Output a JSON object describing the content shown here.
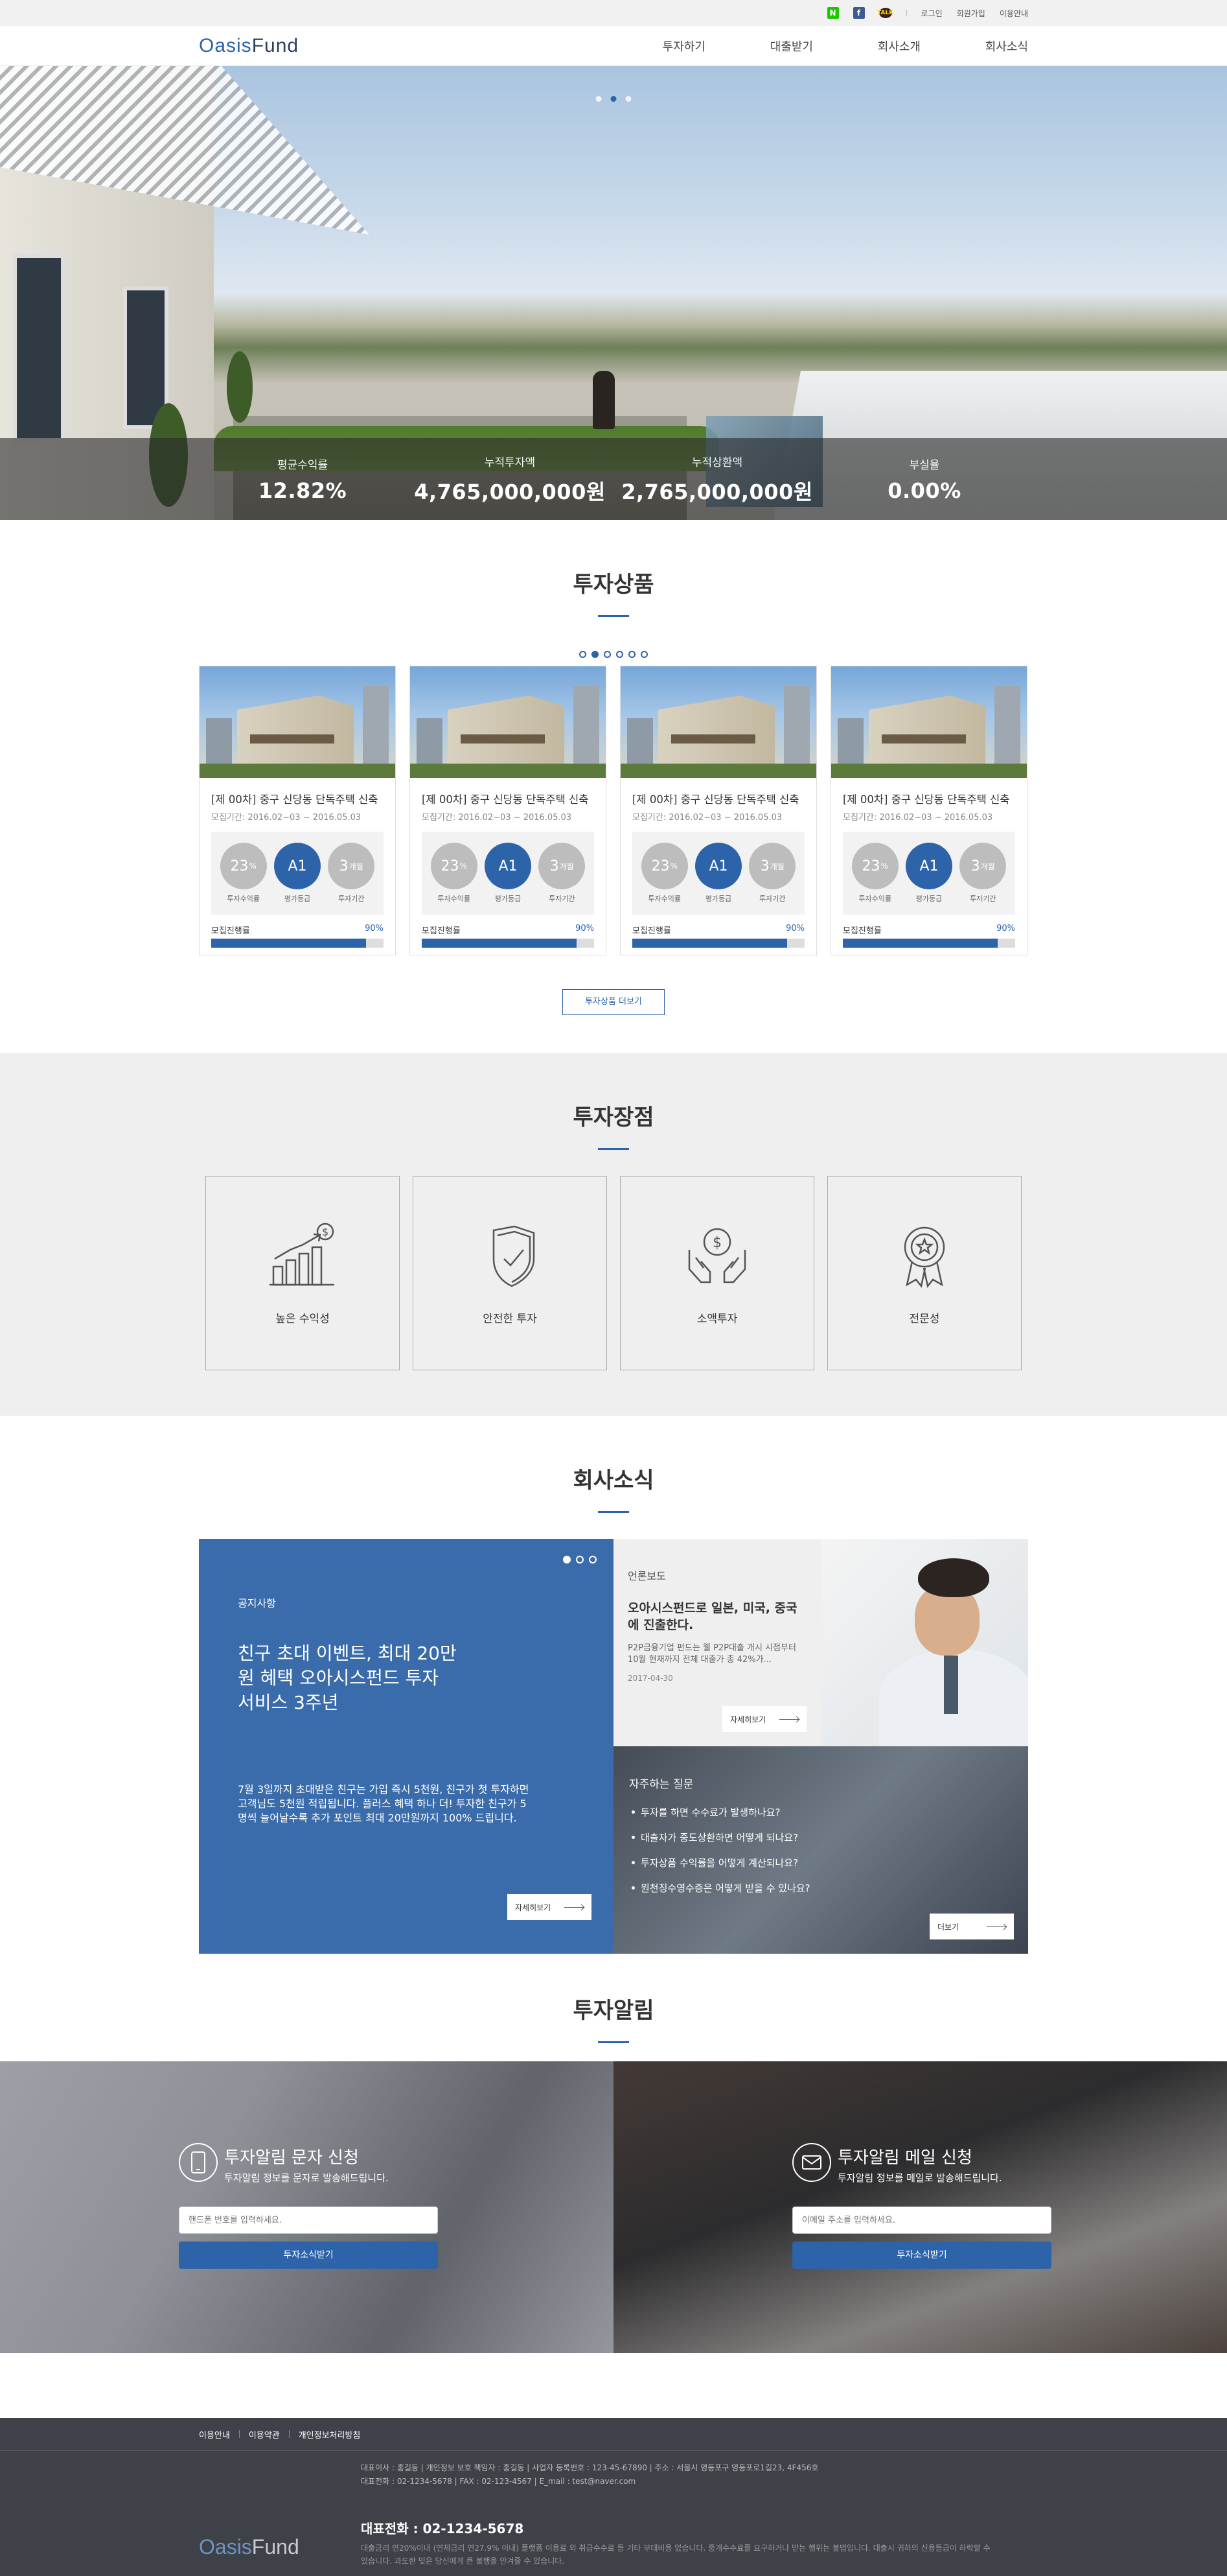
{
  "topbar": {
    "sns": [
      {
        "icon": "naver-icon",
        "glyph": "N",
        "color": "#1ec800"
      },
      {
        "icon": "facebook-icon",
        "glyph": "f",
        "color": "#3b5998"
      },
      {
        "icon": "kakaotalk-icon",
        "glyph": "TALK",
        "color": "#3c1e1e"
      }
    ],
    "links": [
      "로그인",
      "회원가입",
      "이용안내"
    ]
  },
  "header": {
    "logo_a": "Oasis",
    "logo_b": "Fund",
    "nav": [
      "투자하기",
      "대출받기",
      "회사소개",
      "회사소식"
    ]
  },
  "hero": {
    "slide_count": 3,
    "active_slide": 2,
    "stats": [
      {
        "label": "평균수익률",
        "value": "12.82%"
      },
      {
        "label": "누적투자액",
        "value": "4,765,000,000원"
      },
      {
        "label": "누적상환액",
        "value": "2,765,000,000원"
      },
      {
        "label": "부실율",
        "value": "0.00%"
      }
    ]
  },
  "products": {
    "title": "투자상품",
    "page_count": 6,
    "active_page": 2,
    "items": [
      {
        "title": "[제 00차] 중구 신당동 단독주택 신축",
        "period": "모집기간: 2016.02~03 ~ 2016.05.03",
        "rate": "23",
        "rate_unit": "%",
        "rate_label": "투자수익률",
        "grade": "A1",
        "grade_label": "평가등급",
        "term": "3",
        "term_unit": "개월",
        "term_label": "투자기간",
        "progress_label": "모집진행률",
        "progress": 90,
        "progress_text": "90%"
      },
      {
        "title": "[제 00차] 중구 신당동 단독주택 신축",
        "period": "모집기간: 2016.02~03 ~ 2016.05.03",
        "rate": "23",
        "rate_unit": "%",
        "rate_label": "투자수익률",
        "grade": "A1",
        "grade_label": "평가등급",
        "term": "3",
        "term_unit": "개월",
        "term_label": "투자기간",
        "progress_label": "모집진행률",
        "progress": 90,
        "progress_text": "90%"
      },
      {
        "title": "[제 00차] 중구 신당동 단독주택 신축",
        "period": "모집기간: 2016.02~03 ~ 2016.05.03",
        "rate": "23",
        "rate_unit": "%",
        "rate_label": "투자수익률",
        "grade": "A1",
        "grade_label": "평가등급",
        "term": "3",
        "term_unit": "개월",
        "term_label": "투자기간",
        "progress_label": "모집진행률",
        "progress": 90,
        "progress_text": "90%"
      },
      {
        "title": "[제 00차] 중구 신당동 단독주택 신축",
        "period": "모집기간: 2016.02~03 ~ 2016.05.03",
        "rate": "23",
        "rate_unit": "%",
        "rate_label": "투자수익률",
        "grade": "A1",
        "grade_label": "평가등급",
        "term": "3",
        "term_unit": "개월",
        "term_label": "투자기간",
        "progress_label": "모집진행률",
        "progress": 90,
        "progress_text": "90%"
      }
    ],
    "more_label": "투자상품 더보기"
  },
  "advantages": {
    "title": "투자장점",
    "items": [
      {
        "icon": "growth-chart-icon",
        "label": "높은 수익성"
      },
      {
        "icon": "shield-check-icon",
        "label": "안전한 투자"
      },
      {
        "icon": "money-hands-icon",
        "label": "소액투자"
      },
      {
        "icon": "award-badge-icon",
        "label": "전문성"
      }
    ]
  },
  "news": {
    "title": "회사소식",
    "notice": {
      "slide_count": 3,
      "active_slide": 1,
      "category": "공지사항",
      "headline": "친구 초대 이벤트, 최대 20만 원 혜택 오아시스펀드 투자 서비스 3주년",
      "body": "7월 3일까지 초대받은 친구는 가입 즉시 5천원, 친구가 첫 투자하면 고객님도 5천원 적립됩니다. 플러스 혜택 하나 더! 투자한 친구가 5명씩 늘어날수록 추가 포인트 최대 20만원까지 100% 드립니다.",
      "button": "자세히보기"
    },
    "press": {
      "category": "언론보도",
      "headline": "오아시스펀드로 일본, 미국, 중국에 진출한다.",
      "body": "P2P금융기업 펀드는 웰 P2P대출 개시 시점부터 10월 현재까지 전체 대출가 총 42%가...",
      "date": "2017-04-30",
      "button": "자세히보기"
    },
    "faq": {
      "category": "자주하는 질문",
      "items": [
        "투자를 하면 수수료가 발생하나요?",
        "대출자가 중도상환하면 어떻게 되나요?",
        "투자상품 수익률을 어떻게 계산되나요?",
        "원천징수영수증은 어떻게 받을 수 있나요?"
      ],
      "button": "더보기"
    }
  },
  "alert": {
    "title": "투자알림",
    "sms": {
      "icon": "mobile-phone-icon",
      "title": "투자알림 문자 신청",
      "subtitle": "투자알림 정보를 문자로 발송해드립니다.",
      "placeholder": "핸드폰 번호를 입력하세요.",
      "button": "투자소식받기"
    },
    "email": {
      "icon": "mail-icon",
      "title": "투자알림 메일 신청",
      "subtitle": "투자알림 정보를 메일로 발송해드립니다.",
      "placeholder": "이메일 주소를 입력하세요.",
      "button": "투자소식받기"
    }
  },
  "footer": {
    "links": [
      "이용안내",
      "이용약관",
      "개인정보처리방침"
    ],
    "info_line1": "대표이사 : 홍길동  |  개인정보 보호 책임자 : 홍길동  |  사업자 등록번호 : 123-45-67890  |  주소 : 서울시 영등포구 영등포로1길23, 4F456호",
    "info_line2": "대표전화 : 02-1234-5678  |  FAX : 02-123-4567  |  E_mail : test@naver.com",
    "tel": "대표전화 : 02-1234-5678",
    "legal": "대출금리 연20%이내 (연체금리 연27.9% 이내) 플랫폼 이용료 외 취급수수료 등 기타 부대비용 없습니다. 중개수수료를 요구하거나 받는 행위는 불법입니다. 대출시 귀하의 신용등급이 하락할 수 있습니다. 과도한 빚은 당신에게 큰 불행을 안겨줄 수 있습니다.",
    "logo_a": "Oasis",
    "logo_b": "Fund"
  },
  "colors": {
    "brand": "#2c63a9",
    "footer": "#3e4148",
    "notice": "#3a6cab"
  }
}
